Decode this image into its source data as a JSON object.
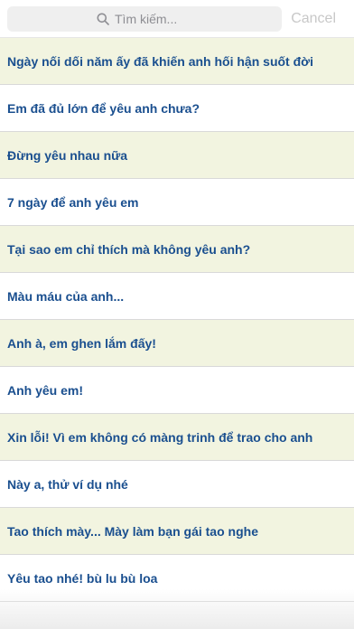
{
  "search": {
    "placeholder": "Tìm kiếm...",
    "cancel_label": "Cancel"
  },
  "items": [
    {
      "title": "Ngày nối dối năm ấy đã khiến anh hối hận suốt đời"
    },
    {
      "title": "Em đã đủ lớn để yêu anh chưa?"
    },
    {
      "title": "Đừng yêu nhau nữa"
    },
    {
      "title": "7 ngày để anh yêu em"
    },
    {
      "title": "Tại sao em chỉ thích mà không yêu anh?"
    },
    {
      "title": "Màu máu của anh..."
    },
    {
      "title": "Anh à, em ghen lắm đấy!"
    },
    {
      "title": "Anh yêu em!"
    },
    {
      "title": "Xin lỗi! Vì em không có màng trinh để trao cho anh"
    },
    {
      "title": "Này a, thử ví dụ nhé"
    },
    {
      "title": "Tao thích mày... Mày làm bạn gái tao nghe"
    },
    {
      "title": "Yêu tao nhé! bù lu bù loa"
    }
  ],
  "colors": {
    "title_text": "#1a4f8f",
    "alt_row_bg": "#f2f4e0",
    "cancel_text": "#c8c8c8"
  }
}
